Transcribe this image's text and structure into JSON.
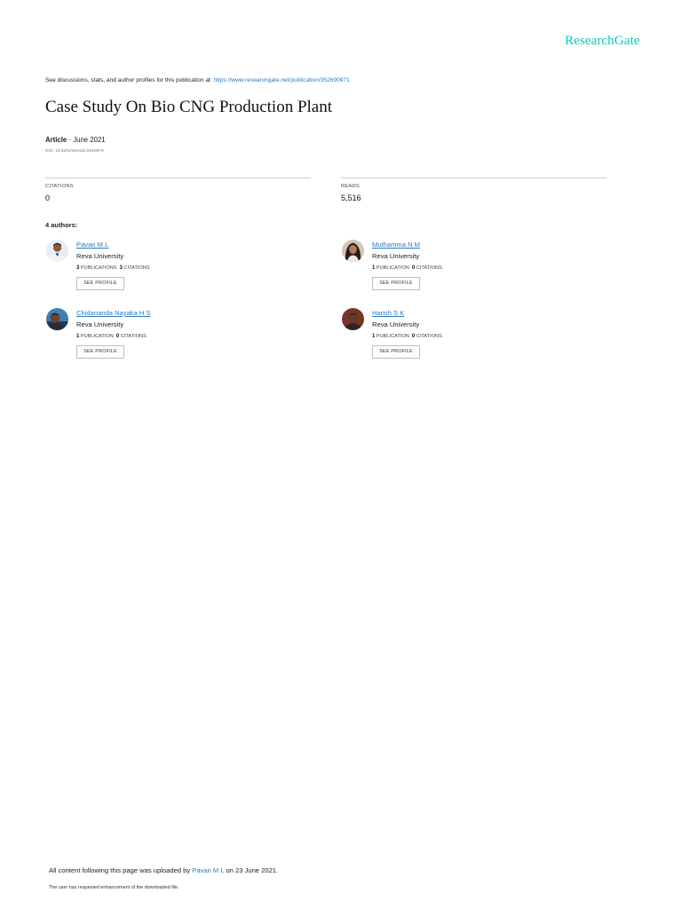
{
  "brand": {
    "logo": "ResearchGate",
    "accent": "#00CCBB",
    "link_color": "#2a7bbf"
  },
  "header": {
    "discussion_prefix": "See discussions, stats, and author profiles for this publication at:",
    "publication_url": "https://www.researchgate.net/publication/352690971"
  },
  "article": {
    "title": "Case Study On Bio CNG Production Plant",
    "type": "Article",
    "date": "· June 2021",
    "doi": "DOI: 10.5281/zenodo.5018970"
  },
  "stats": {
    "citations_label": "CITATIONS",
    "citations_value": "0",
    "reads_label": "READS",
    "reads_value": "5,516"
  },
  "authors_heading": "4 authors:",
  "authors": [
    {
      "name": "Pavan M L",
      "institution": "Reva University",
      "pub_count": "3",
      "pub_label": "PUBLICATIONS",
      "cit_count": "3",
      "cit_label": "CITATIONS",
      "button": "SEE PROFILE",
      "avatar_icon": "person-photo-icon"
    },
    {
      "name": "Muthamma N M",
      "institution": "Reva University",
      "pub_count": "1",
      "pub_label": "PUBLICATION",
      "cit_count": "0",
      "cit_label": "CITATIONS",
      "button": "SEE PROFILE",
      "avatar_icon": "person-photo-icon"
    },
    {
      "name": "Chidananda Nayaka H S",
      "institution": "Reva University",
      "pub_count": "1",
      "pub_label": "PUBLICATION",
      "cit_count": "0",
      "cit_label": "CITATIONS",
      "button": "SEE PROFILE",
      "avatar_icon": "person-photo-icon"
    },
    {
      "name": "Harish S K",
      "institution": "Reva University",
      "pub_count": "1",
      "pub_label": "PUBLICATION",
      "cit_count": "0",
      "cit_label": "CITATIONS",
      "button": "SEE PROFILE",
      "avatar_icon": "person-photo-icon"
    }
  ],
  "footer": {
    "uploaded_prefix": "All content following this page was uploaded by",
    "uploader": "Pavan M L",
    "uploaded_suffix": "on 23 June 2021.",
    "enhancement_note": "The user has requested enhancement of the downloaded file."
  }
}
